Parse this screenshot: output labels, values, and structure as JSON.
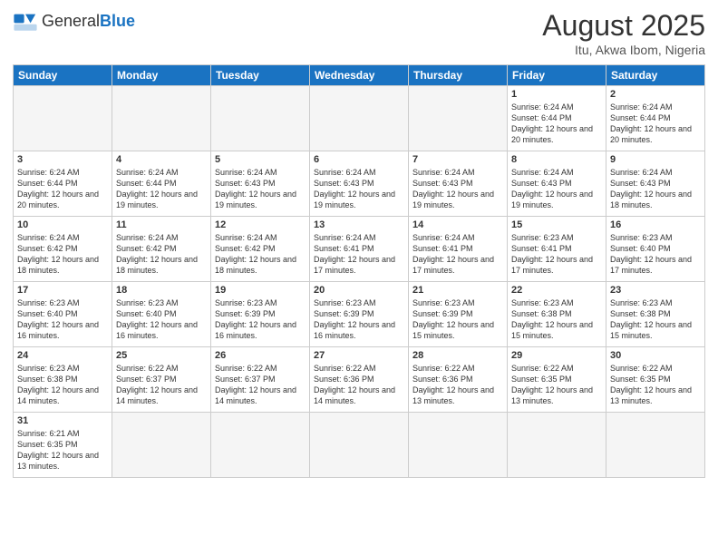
{
  "logo": {
    "text_general": "General",
    "text_blue": "Blue"
  },
  "header": {
    "title": "August 2025",
    "subtitle": "Itu, Akwa Ibom, Nigeria"
  },
  "weekdays": [
    "Sunday",
    "Monday",
    "Tuesday",
    "Wednesday",
    "Thursday",
    "Friday",
    "Saturday"
  ],
  "weeks": [
    [
      {
        "day": "",
        "empty": true
      },
      {
        "day": "",
        "empty": true
      },
      {
        "day": "",
        "empty": true
      },
      {
        "day": "",
        "empty": true
      },
      {
        "day": "",
        "empty": true
      },
      {
        "day": "1",
        "sunrise": "Sunrise: 6:24 AM",
        "sunset": "Sunset: 6:44 PM",
        "daylight": "Daylight: 12 hours and 20 minutes."
      },
      {
        "day": "2",
        "sunrise": "Sunrise: 6:24 AM",
        "sunset": "Sunset: 6:44 PM",
        "daylight": "Daylight: 12 hours and 20 minutes."
      }
    ],
    [
      {
        "day": "3",
        "sunrise": "Sunrise: 6:24 AM",
        "sunset": "Sunset: 6:44 PM",
        "daylight": "Daylight: 12 hours and 20 minutes."
      },
      {
        "day": "4",
        "sunrise": "Sunrise: 6:24 AM",
        "sunset": "Sunset: 6:44 PM",
        "daylight": "Daylight: 12 hours and 19 minutes."
      },
      {
        "day": "5",
        "sunrise": "Sunrise: 6:24 AM",
        "sunset": "Sunset: 6:43 PM",
        "daylight": "Daylight: 12 hours and 19 minutes."
      },
      {
        "day": "6",
        "sunrise": "Sunrise: 6:24 AM",
        "sunset": "Sunset: 6:43 PM",
        "daylight": "Daylight: 12 hours and 19 minutes."
      },
      {
        "day": "7",
        "sunrise": "Sunrise: 6:24 AM",
        "sunset": "Sunset: 6:43 PM",
        "daylight": "Daylight: 12 hours and 19 minutes."
      },
      {
        "day": "8",
        "sunrise": "Sunrise: 6:24 AM",
        "sunset": "Sunset: 6:43 PM",
        "daylight": "Daylight: 12 hours and 19 minutes."
      },
      {
        "day": "9",
        "sunrise": "Sunrise: 6:24 AM",
        "sunset": "Sunset: 6:43 PM",
        "daylight": "Daylight: 12 hours and 18 minutes."
      }
    ],
    [
      {
        "day": "10",
        "sunrise": "Sunrise: 6:24 AM",
        "sunset": "Sunset: 6:42 PM",
        "daylight": "Daylight: 12 hours and 18 minutes."
      },
      {
        "day": "11",
        "sunrise": "Sunrise: 6:24 AM",
        "sunset": "Sunset: 6:42 PM",
        "daylight": "Daylight: 12 hours and 18 minutes."
      },
      {
        "day": "12",
        "sunrise": "Sunrise: 6:24 AM",
        "sunset": "Sunset: 6:42 PM",
        "daylight": "Daylight: 12 hours and 18 minutes."
      },
      {
        "day": "13",
        "sunrise": "Sunrise: 6:24 AM",
        "sunset": "Sunset: 6:41 PM",
        "daylight": "Daylight: 12 hours and 17 minutes."
      },
      {
        "day": "14",
        "sunrise": "Sunrise: 6:24 AM",
        "sunset": "Sunset: 6:41 PM",
        "daylight": "Daylight: 12 hours and 17 minutes."
      },
      {
        "day": "15",
        "sunrise": "Sunrise: 6:23 AM",
        "sunset": "Sunset: 6:41 PM",
        "daylight": "Daylight: 12 hours and 17 minutes."
      },
      {
        "day": "16",
        "sunrise": "Sunrise: 6:23 AM",
        "sunset": "Sunset: 6:40 PM",
        "daylight": "Daylight: 12 hours and 17 minutes."
      }
    ],
    [
      {
        "day": "17",
        "sunrise": "Sunrise: 6:23 AM",
        "sunset": "Sunset: 6:40 PM",
        "daylight": "Daylight: 12 hours and 16 minutes."
      },
      {
        "day": "18",
        "sunrise": "Sunrise: 6:23 AM",
        "sunset": "Sunset: 6:40 PM",
        "daylight": "Daylight: 12 hours and 16 minutes."
      },
      {
        "day": "19",
        "sunrise": "Sunrise: 6:23 AM",
        "sunset": "Sunset: 6:39 PM",
        "daylight": "Daylight: 12 hours and 16 minutes."
      },
      {
        "day": "20",
        "sunrise": "Sunrise: 6:23 AM",
        "sunset": "Sunset: 6:39 PM",
        "daylight": "Daylight: 12 hours and 16 minutes."
      },
      {
        "day": "21",
        "sunrise": "Sunrise: 6:23 AM",
        "sunset": "Sunset: 6:39 PM",
        "daylight": "Daylight: 12 hours and 15 minutes."
      },
      {
        "day": "22",
        "sunrise": "Sunrise: 6:23 AM",
        "sunset": "Sunset: 6:38 PM",
        "daylight": "Daylight: 12 hours and 15 minutes."
      },
      {
        "day": "23",
        "sunrise": "Sunrise: 6:23 AM",
        "sunset": "Sunset: 6:38 PM",
        "daylight": "Daylight: 12 hours and 15 minutes."
      }
    ],
    [
      {
        "day": "24",
        "sunrise": "Sunrise: 6:23 AM",
        "sunset": "Sunset: 6:38 PM",
        "daylight": "Daylight: 12 hours and 14 minutes."
      },
      {
        "day": "25",
        "sunrise": "Sunrise: 6:22 AM",
        "sunset": "Sunset: 6:37 PM",
        "daylight": "Daylight: 12 hours and 14 minutes."
      },
      {
        "day": "26",
        "sunrise": "Sunrise: 6:22 AM",
        "sunset": "Sunset: 6:37 PM",
        "daylight": "Daylight: 12 hours and 14 minutes."
      },
      {
        "day": "27",
        "sunrise": "Sunrise: 6:22 AM",
        "sunset": "Sunset: 6:36 PM",
        "daylight": "Daylight: 12 hours and 14 minutes."
      },
      {
        "day": "28",
        "sunrise": "Sunrise: 6:22 AM",
        "sunset": "Sunset: 6:36 PM",
        "daylight": "Daylight: 12 hours and 13 minutes."
      },
      {
        "day": "29",
        "sunrise": "Sunrise: 6:22 AM",
        "sunset": "Sunset: 6:35 PM",
        "daylight": "Daylight: 12 hours and 13 minutes."
      },
      {
        "day": "30",
        "sunrise": "Sunrise: 6:22 AM",
        "sunset": "Sunset: 6:35 PM",
        "daylight": "Daylight: 12 hours and 13 minutes."
      }
    ],
    [
      {
        "day": "31",
        "sunrise": "Sunrise: 6:21 AM",
        "sunset": "Sunset: 6:35 PM",
        "daylight": "Daylight: 12 hours and 13 minutes."
      },
      {
        "day": "",
        "empty": true
      },
      {
        "day": "",
        "empty": true
      },
      {
        "day": "",
        "empty": true
      },
      {
        "day": "",
        "empty": true
      },
      {
        "day": "",
        "empty": true
      },
      {
        "day": "",
        "empty": true
      }
    ]
  ]
}
